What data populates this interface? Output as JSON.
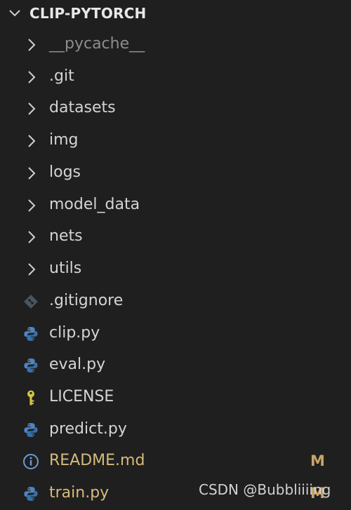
{
  "explorer": {
    "root_title": "CLIP-PYTORCH",
    "items": [
      {
        "label": "__pycache__",
        "kind": "folder",
        "icon": "chevron-right-icon",
        "dim": true
      },
      {
        "label": ".git",
        "kind": "folder",
        "icon": "chevron-right-icon"
      },
      {
        "label": "datasets",
        "kind": "folder",
        "icon": "chevron-right-icon"
      },
      {
        "label": "img",
        "kind": "folder",
        "icon": "chevron-right-icon"
      },
      {
        "label": "logs",
        "kind": "folder",
        "icon": "chevron-right-icon"
      },
      {
        "label": "model_data",
        "kind": "folder",
        "icon": "chevron-right-icon"
      },
      {
        "label": "nets",
        "kind": "folder",
        "icon": "chevron-right-icon"
      },
      {
        "label": "utils",
        "kind": "folder",
        "icon": "chevron-right-icon"
      },
      {
        "label": ".gitignore",
        "kind": "file",
        "icon": "git-diamond-icon"
      },
      {
        "label": "clip.py",
        "kind": "file",
        "icon": "python-icon"
      },
      {
        "label": "eval.py",
        "kind": "file",
        "icon": "python-icon"
      },
      {
        "label": "LICENSE",
        "kind": "file",
        "icon": "key-icon"
      },
      {
        "label": "predict.py",
        "kind": "file",
        "icon": "python-icon"
      },
      {
        "label": "README.md",
        "kind": "file",
        "icon": "info-icon",
        "badge": "M"
      },
      {
        "label": "train.py",
        "kind": "file",
        "icon": "python-icon",
        "badge": "M"
      }
    ]
  },
  "watermark": "CSDN @Bubbliiiing",
  "colors": {
    "background": "#1f1f1f",
    "text": "#d4d4d4",
    "modified": "#d7ba7d",
    "python_blue": "#3f7fbf",
    "key_yellow": "#d4c44a"
  }
}
